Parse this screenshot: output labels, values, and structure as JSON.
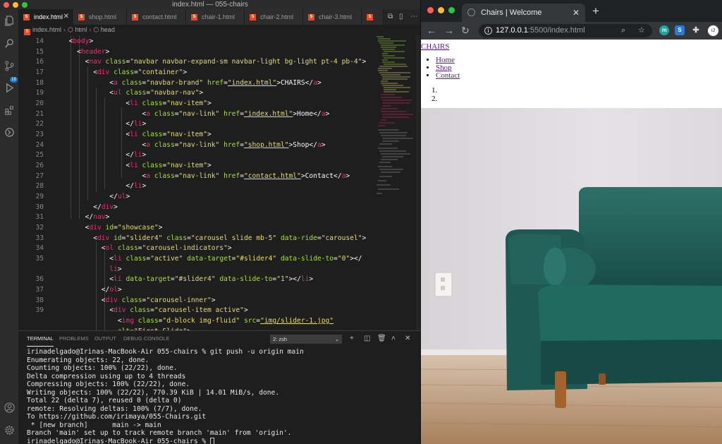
{
  "vscode": {
    "window_title": "index.html — 055-chairs",
    "activity_badge": "18",
    "tabs": [
      {
        "label": "index.html",
        "active": true
      },
      {
        "label": "shop.html"
      },
      {
        "label": "contact.html"
      },
      {
        "label": "chair-1.html"
      },
      {
        "label": "chair-2.html"
      },
      {
        "label": "chair-3.html"
      }
    ],
    "breadcrumb": [
      "index.html",
      "html",
      "head"
    ],
    "line_numbers": [
      "14",
      "15",
      "16",
      "17",
      "18",
      "19",
      "20",
      "21",
      "22",
      "23",
      "24",
      "25",
      "26",
      "27",
      "28",
      "29",
      "30",
      "31",
      "32",
      "33",
      "34",
      "35",
      "",
      "36",
      "37",
      "38",
      "39",
      ""
    ],
    "panel": {
      "tabs": [
        "TERMINAL",
        "PROBLEMS",
        "OUTPUT",
        "DEBUG CONSOLE"
      ],
      "shell": "2: zsh"
    },
    "terminal_lines": [
      "irinadelgado@Irinas-MacBook-Air 055-chairs % git push -u origin main",
      "Enumerating objects: 22, done.",
      "Counting objects: 100% (22/22), done.",
      "Delta compression using up to 4 threads",
      "Compressing objects: 100% (22/22), done.",
      "Writing objects: 100% (22/22), 770.39 KiB | 14.01 MiB/s, done.",
      "Total 22 (delta 7), reused 0 (delta 0)",
      "remote: Resolving deltas: 100% (7/7), done.",
      "To https://github.com/irimaya/055-Chairs.git",
      " * [new branch]      main -> main",
      "Branch 'main' set up to track remote branch 'main' from 'origin'.",
      "irinadelgado@Irinas-MacBook-Air 055-chairs % "
    ]
  },
  "browser": {
    "tab_title": "Chairs | Welcome",
    "url_host": "127.0.0.1",
    "url_rest": ":5500/index.html",
    "profile_initials": "iJ",
    "page": {
      "brand": "CHAIRS",
      "nav": [
        "Home",
        "Shop",
        "Contact"
      ],
      "indicators": [
        "",
        ""
      ]
    }
  },
  "colors": {
    "vscode_bg": "#1e1e1e",
    "tag": "#f92672",
    "attr": "#a6e22e",
    "string": "#e6db74",
    "sofa": "#1f5c55",
    "floor": "#b9906b"
  }
}
